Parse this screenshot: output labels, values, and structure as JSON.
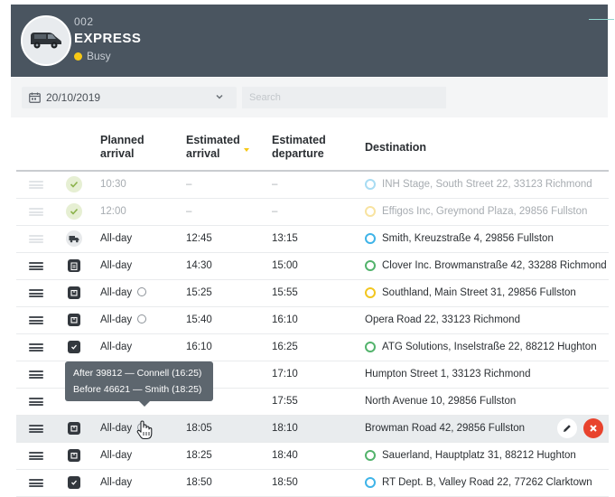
{
  "vehicle": {
    "id": "002",
    "name": "EXPRESS",
    "status": "Busy",
    "status_color": "#f6c816",
    "avatar_icon": "van-icon"
  },
  "filters": {
    "date": "20/10/2019",
    "search_placeholder": "Search"
  },
  "table": {
    "headers": {
      "planned": [
        "Planned",
        "arrival"
      ],
      "estimated_arrival": [
        "Estimated",
        "arrival"
      ],
      "estimated_departure": [
        "Estimated",
        "departure"
      ],
      "destination": "Destination"
    },
    "rows": [
      {
        "type_icon": "check-icon",
        "planned": "10:30",
        "arrival": "–",
        "departure": "–",
        "dest_marker": "blue",
        "destination": "INH Stage, South Street 22, 33123 Richmond",
        "muted": true
      },
      {
        "type_icon": "check-icon",
        "planned": "12:00",
        "arrival": "–",
        "departure": "–",
        "dest_marker": "yellow",
        "destination": "Effigos Inc, Greymond Plaza, 29856 Fullston",
        "muted": true
      },
      {
        "type_icon": "truck-icon",
        "planned": "All-day",
        "arrival": "12:45",
        "departure": "13:15",
        "dest_marker": "blue",
        "destination": "Smith, Kreuzstraße 4, 29856 Fullston"
      },
      {
        "type_icon": "clipboard-icon",
        "planned": "All-day",
        "arrival": "14:30",
        "departure": "15:00",
        "dest_marker": "green",
        "destination": "Clover Inc. Browmanstraße 42, 33288 Richmond"
      },
      {
        "type_icon": "package-icon",
        "planned": "All-day",
        "arrival": "15:25",
        "departure": "15:55",
        "dest_marker": "yellow",
        "destination": "Southland, Main Street 31, 29856 Fullston",
        "clock": true
      },
      {
        "type_icon": "package-icon",
        "planned": "All-day",
        "arrival": "15:40",
        "departure": "16:10",
        "dest_marker": "none",
        "destination": "Opera Road 22, 33123 Richmond",
        "clock": true
      },
      {
        "type_icon": "checkbox-icon",
        "planned": "All-day",
        "arrival": "16:10",
        "departure": "16:25",
        "dest_marker": "green",
        "destination": "ATG Solutions, Inselstraße 22, 88212 Hughton"
      },
      {
        "type_icon": "",
        "planned": "",
        "arrival": "",
        "departure": "17:10",
        "dest_marker": "none",
        "destination": "Humpton Street 1, 33123 Richmond"
      },
      {
        "type_icon": "",
        "planned": "",
        "arrival": "",
        "departure": "17:55",
        "dest_marker": "none",
        "destination": "North Avenue 10, 29856 Fullston"
      },
      {
        "type_icon": "package-icon",
        "planned": "All-day",
        "arrival": "18:05",
        "departure": "18:10",
        "dest_marker": "none",
        "destination": "Browman Road 42, 29856 Fullston",
        "clock": true,
        "highlighted": true
      },
      {
        "type_icon": "package-icon",
        "planned": "All-day",
        "arrival": "18:25",
        "departure": "18:40",
        "dest_marker": "green",
        "destination": "Sauerland, Hauptplatz 31, 88212 Hughton"
      },
      {
        "type_icon": "checkbox-icon",
        "planned": "All-day",
        "arrival": "18:50",
        "departure": "18:50",
        "dest_marker": "blue",
        "destination": "RT Dept. B, Valley Road 22, 77262 Clarktown"
      }
    ]
  },
  "tooltip": {
    "line1": "After 39812 — Connell (16:25)",
    "line2": "Before 46621 — Smith (18:25)"
  },
  "colors": {
    "header_bg": "#4a5560",
    "marker_blue": "#3fb4e8",
    "marker_green": "#53b36c",
    "marker_yellow": "#f2c61f",
    "delete_red": "#e8432d"
  }
}
